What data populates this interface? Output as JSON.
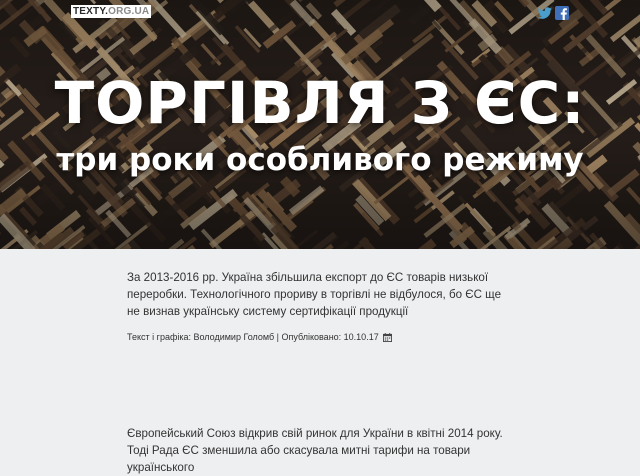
{
  "header": {
    "logo_part1": "TEXTY.",
    "logo_part2": "ORG.UA",
    "social_icons": [
      "twitter-icon",
      "facebook-icon"
    ]
  },
  "hero": {
    "title": "ТОРГІВЛЯ З ЄС:",
    "subtitle": "три роки особливого режиму"
  },
  "article": {
    "lead": "За 2013-2016 рр. Україна збільшила експорт до ЄС товарів низької переробки. Технологічного прориву в торгівлі не відбулося, бо ЄС ще не визнав українську систему сертифікації продукції",
    "byline": "Текст і графіка: Володимир Голомб | Опубліковано: 10.10.17",
    "byline_icon": "calendar-icon",
    "body": "Європейський Союз відкрив свій ринок для України в квітні 2014 року. Тоді Рада ЄС зменшила або скасувала митні тарифи на товари українського"
  },
  "colors": {
    "page_bg": "#eeeff1",
    "twitter": "#4a9ecc",
    "facebook": "#3e6fb8"
  }
}
